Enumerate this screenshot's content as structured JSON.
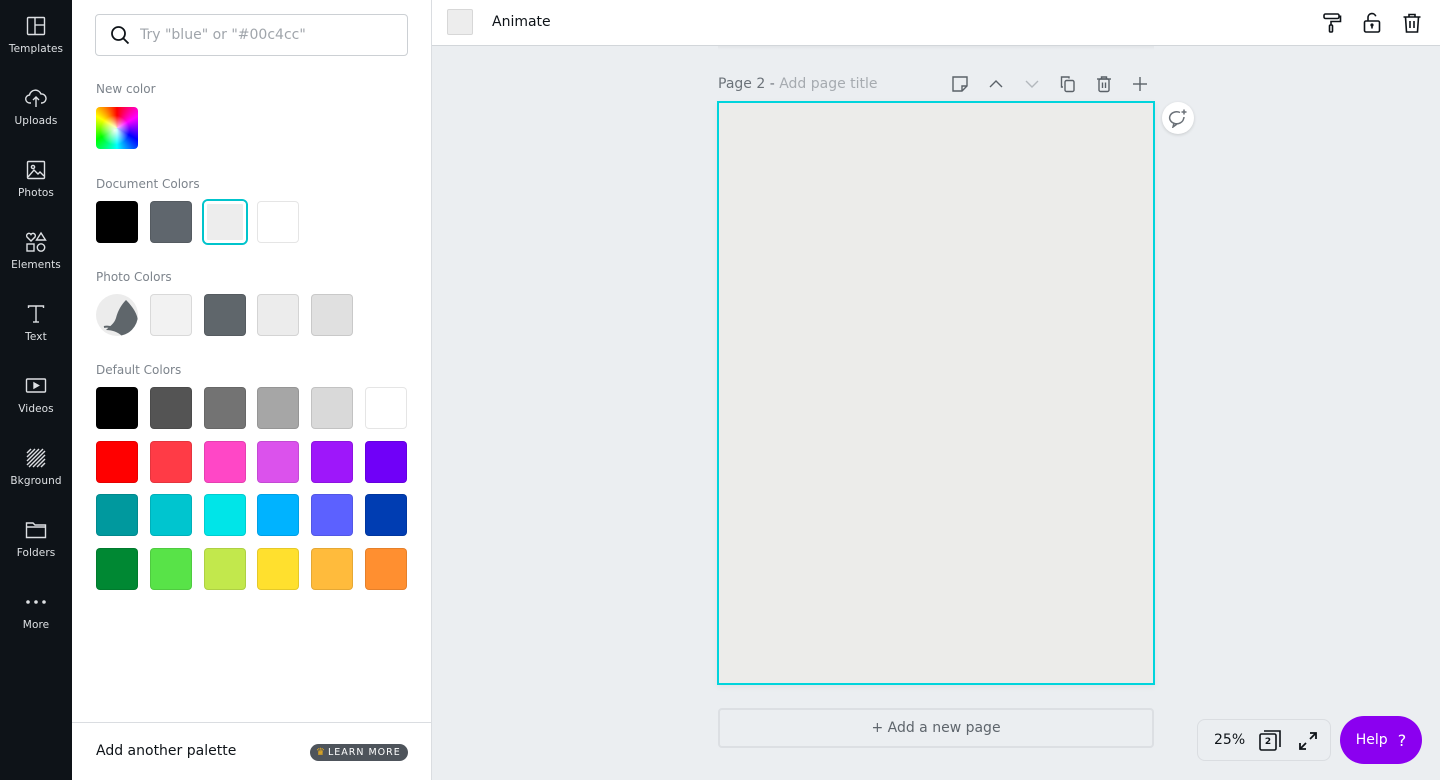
{
  "nav": {
    "items": [
      {
        "label": "Templates",
        "icon": "templates-icon"
      },
      {
        "label": "Uploads",
        "icon": "upload-cloud-icon"
      },
      {
        "label": "Photos",
        "icon": "photo-icon"
      },
      {
        "label": "Elements",
        "icon": "shapes-icon"
      },
      {
        "label": "Text",
        "icon": "text-icon"
      },
      {
        "label": "Videos",
        "icon": "video-icon"
      },
      {
        "label": "Bkground",
        "icon": "background-hatch-icon"
      },
      {
        "label": "Folders",
        "icon": "folder-icon"
      },
      {
        "label": "More",
        "icon": "more-dots-icon"
      }
    ]
  },
  "panel": {
    "search": {
      "placeholder": "Try \"blue\" or \"#00c4cc\"",
      "value": ""
    },
    "new_color": {
      "title": "New color"
    },
    "document_colors": {
      "title": "Document Colors",
      "colors": [
        "#000000",
        "#5f666d",
        "#ededed",
        "#ffffff"
      ],
      "selected_index": 2
    },
    "photo_colors": {
      "title": "Photo Colors",
      "colors": [
        "#f2f2f2",
        "#5f666b",
        "#ececec",
        "#e0e0e0"
      ]
    },
    "default_colors": {
      "title": "Default Colors",
      "rows": [
        [
          "#000000",
          "#545454",
          "#737373",
          "#a6a6a6",
          "#d9d9d9",
          "#ffffff"
        ],
        [
          "#ff0000",
          "#ff3b46",
          "#ff47c6",
          "#db52ec",
          "#9e17fa",
          "#7000f8"
        ],
        [
          "#00999e",
          "#00c5cf",
          "#00e5e8",
          "#00b3ff",
          "#5c61ff",
          "#003db2"
        ],
        [
          "#008833",
          "#58e348",
          "#c2e84c",
          "#ffe02e",
          "#ffbb3c",
          "#ff8f30"
        ]
      ]
    },
    "footer": {
      "add_palette": "Add another palette",
      "learn_more": "LEARN MORE"
    }
  },
  "topbar": {
    "current_color": "#ededed",
    "animate_label": "Animate"
  },
  "canvas": {
    "page_prefix": "Page 2 - ",
    "page_title_placeholder": "Add page title",
    "page_background": "#ececea",
    "selection_color": "#00d4dc",
    "add_page_label": "+ Add a new page"
  },
  "footer": {
    "zoom": "25%",
    "page_count": "2",
    "help_label": "Help",
    "help_q": "?"
  }
}
